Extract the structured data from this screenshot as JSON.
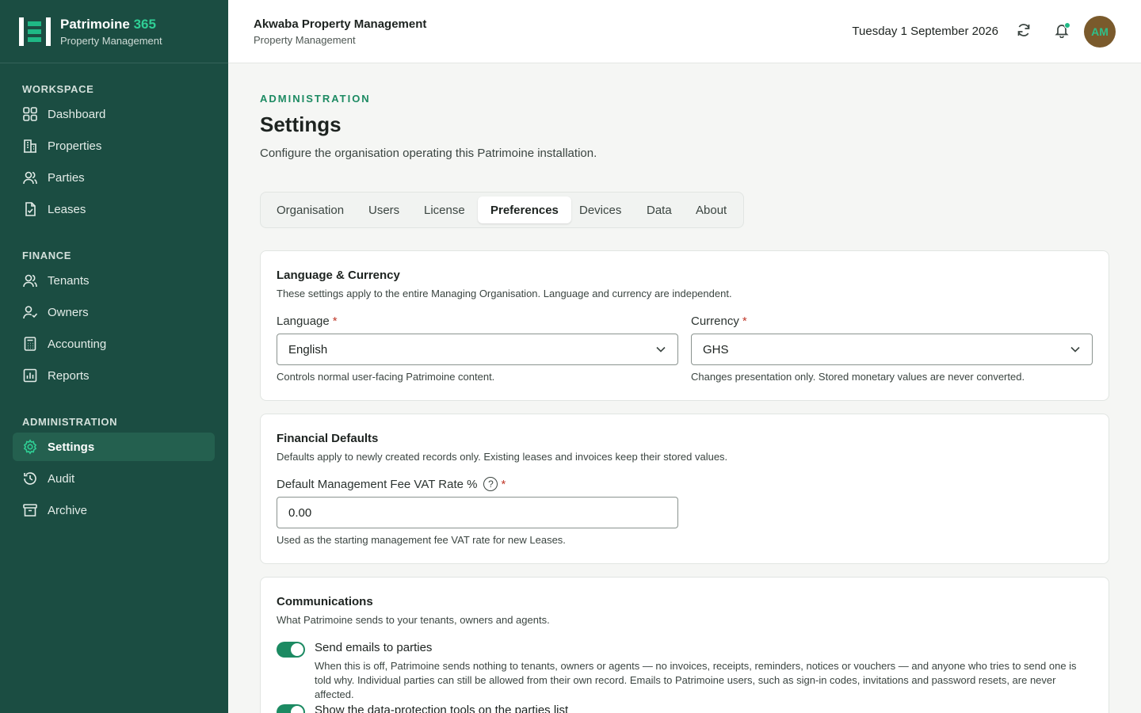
{
  "brand": {
    "name": "Patrimoine",
    "name_accent": "365",
    "subtitle": "Property Management"
  },
  "sidebar": {
    "sections": [
      {
        "title": "WORKSPACE"
      },
      {
        "title": "FINANCE"
      },
      {
        "title": "ADMINISTRATION"
      }
    ],
    "items": [
      {
        "label": "Dashboard",
        "icon": "dashboard-icon"
      },
      {
        "label": "Properties",
        "icon": "building-icon"
      },
      {
        "label": "Parties",
        "icon": "users-icon"
      },
      {
        "label": "Leases",
        "icon": "document-icon"
      },
      {
        "label": "Tenants",
        "icon": "users-icon"
      },
      {
        "label": "Owners",
        "icon": "user-check-icon"
      },
      {
        "label": "Accounting",
        "icon": "calculator-icon"
      },
      {
        "label": "Reports",
        "icon": "chart-icon"
      },
      {
        "label": "Settings",
        "icon": "gear-icon",
        "active": true
      },
      {
        "label": "Audit",
        "icon": "history-icon"
      },
      {
        "label": "Archive",
        "icon": "archive-icon"
      }
    ]
  },
  "header": {
    "org_name": "Akwaba Property Management",
    "org_subtitle": "Property Management",
    "date": "Tuesday 1 September 2026",
    "avatar_initials": "AM"
  },
  "page": {
    "kicker": "ADMINISTRATION",
    "title": "Settings",
    "description": "Configure the organisation operating this Patrimoine installation."
  },
  "tabs": [
    {
      "label": "Organisation"
    },
    {
      "label": "Users"
    },
    {
      "label": "License"
    },
    {
      "label": "Preferences",
      "active": true
    },
    {
      "label": "Devices"
    },
    {
      "label": "Data"
    },
    {
      "label": "About"
    }
  ],
  "language_currency": {
    "title": "Language & Currency",
    "description": "These settings apply to the entire Managing Organisation. Language and currency are independent.",
    "language_label": "Language",
    "language_value": "English",
    "language_hint": "Controls normal user-facing Patrimoine content.",
    "currency_label": "Currency",
    "currency_value": "GHS",
    "currency_hint": "Changes presentation only. Stored monetary values are never converted.",
    "required_mark": "*"
  },
  "financial_defaults": {
    "title": "Financial Defaults",
    "description": "Defaults apply to newly created records only. Existing leases and invoices keep their stored values.",
    "vat_label": "Default Management Fee VAT Rate %",
    "help_glyph": "?",
    "vat_value": "0.00",
    "vat_hint": "Used as the starting management fee VAT rate for new Leases."
  },
  "communications": {
    "title": "Communications",
    "description": "What Patrimoine sends to your tenants, owners and agents.",
    "toggles": [
      {
        "label": "Send emails to parties",
        "enabled": true,
        "description": "When this is off, Patrimoine sends nothing to tenants, owners or agents — no invoices, receipts, reminders, notices or vouchers — and anyone who tries to send one is told why. Individual parties can still be allowed from their own record. Emails to Patrimoine users, such as sign-in codes, invitations and password resets, are never affected."
      },
      {
        "label": "Show the data-protection tools on the parties list",
        "enabled": true
      }
    ]
  },
  "colors": {
    "sidebar_bg": "#1b4d42",
    "accent": "#1c8a62",
    "brand_accent": "#2fcf95",
    "required": "#c0392b"
  }
}
